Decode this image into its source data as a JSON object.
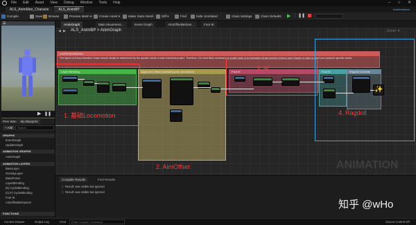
{
  "titlebar": {
    "menu": [
      "File",
      "Edit",
      "Asset",
      "View",
      "Debug",
      "Window",
      "Tools",
      "Help"
    ],
    "parent_class": "Parent class:",
    "parent_value": "AnimInstance"
  },
  "doc_tabs": [
    "ALS_AnimMan_Characte",
    "ALS_AnimBP"
  ],
  "toolbar": {
    "compile": "Compile",
    "save": "Save",
    "browse": "Browse",
    "preview_mesh": "Preview Mesh",
    "create_asset": "Create Asset",
    "make_static_mesh": "Make Static Mesh",
    "diff": "Diff",
    "find": "Find",
    "hide_unrelated": "Hide Unrelated",
    "class_settings": "Class Settings",
    "class_defaults": "Class Defaults"
  },
  "left_panel": {
    "persona_tabs": [
      "Prev Wan",
      "My Blueprint"
    ],
    "add_label": "+ Add",
    "search_placeholder": "Search",
    "sections": [
      {
        "title": "GRAPHS",
        "items": [
          "EventGraph",
          "UpdateGraph"
        ]
      },
      {
        "title": "ANIMATION GRAPHS",
        "items": [
          "AnimGraph"
        ]
      },
      {
        "title": "ANIMATION LAYERS",
        "items": [
          "BaseLayer",
          "OverlayLayer",
          "BasePoses",
          "LayerBlending",
          "(N) CycleBlending",
          "(CLF) CycleBlending",
          "Foot IK",
          "AimOffsetBehaviors"
        ]
      },
      {
        "title": "FUNCTIONS",
        "items": []
      }
    ]
  },
  "graph_tabs": [
    "AnimGraph",
    "Main Movement...",
    "Event Graph",
    "AimOffsetBehavi...",
    "Foot IK"
  ],
  "breadcrumb": "ALS_AnimBP > AnimGraph",
  "zoom": "Zoom -4",
  "comments": [
    {
      "title": "LAYER BLENDING",
      "color": "#cf5a5a"
    },
    {
      "title": "Layer Blending",
      "color": "#46b446"
    },
    {
      "title": "Apply Aim Offset (contains pose procedure)",
      "color": "#b9ac5f"
    },
    {
      "title": "Foot IK",
      "color": "#b44a66"
    },
    {
      "title": "Foot IK",
      "color": "#48a0a0"
    },
    {
      "title": "Ragdoll Override",
      "color": "#6a8696"
    }
  ],
  "comment_body": "The layout of every Animation Graph should ideally be determined by the specific needs of each individual project. Therefore, it is most likely necessary to modify parts of an Animation Graph and the Linked Layer Graphs in order to meet your project's specific needs.",
  "annotations": [
    "1. 基础Locomotion",
    "2. AimOffset",
    "3. IK",
    "4. Ragdoll"
  ],
  "graph_watermark": "ANIMATION",
  "bottom": {
    "tabs": [
      "Compiler Results",
      "Find Results"
    ],
    "lines": [
      "Result: was visible but ignored",
      "Result: was visible but ignored"
    ]
  },
  "statusbar": {
    "content_drawer": "Content Drawer",
    "output_log": "Output Log",
    "cmd": "Cmd",
    "console_placeholder": "Enter Console Command",
    "source_control": "Source Control Off"
  },
  "watermark": "知乎 @wHo",
  "colors": {
    "red_annotation": "#ff3c3c",
    "node_header_green": "#3a8a3a",
    "node_header_blue": "#3a6aa0"
  }
}
